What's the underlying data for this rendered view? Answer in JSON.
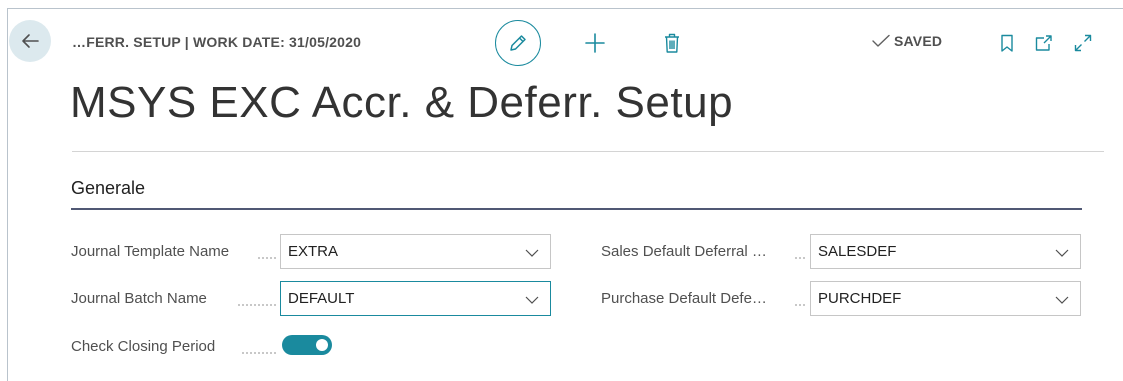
{
  "header": {
    "breadcrumb": "…FERR. SETUP | WORK DATE: 31/05/2020",
    "saved_label": "SAVED",
    "icons": [
      "back-arrow-icon",
      "pencil-icon",
      "plus-icon",
      "trash-icon",
      "check-icon",
      "bookmark-icon",
      "open-new-window-icon",
      "expand-icon"
    ]
  },
  "page": {
    "title": "MSYS EXC Accr. & Deferr. Setup"
  },
  "section": {
    "title": "Generale"
  },
  "fields": {
    "journal_template": {
      "label": "Journal Template Name",
      "value": "EXTRA"
    },
    "journal_batch": {
      "label": "Journal Batch Name",
      "value": "DEFAULT"
    },
    "check_closing": {
      "label": "Check Closing Period",
      "value": true
    },
    "sales_deferral": {
      "label": "Sales Default Deferral …",
      "value": "SALESDEF"
    },
    "purchase_deferral": {
      "label": "Purchase Default Defe…",
      "value": "PURCHDEF"
    }
  },
  "colors": {
    "accent": "#1a8a9e",
    "section_rule": "#505874",
    "back_button_bg": "#dce9ee"
  }
}
